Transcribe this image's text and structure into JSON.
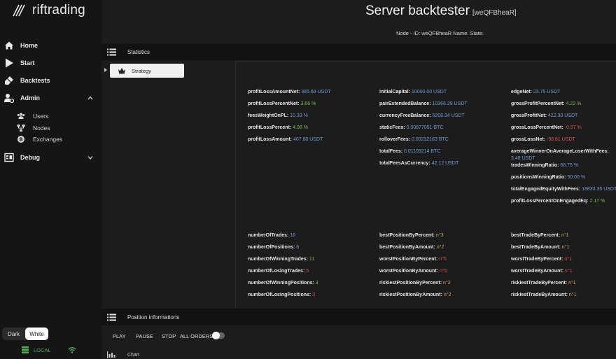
{
  "sidebar": {
    "brand": "riftrading",
    "nav": {
      "home": "Home",
      "start": "Start",
      "backtests": "Backtests",
      "admin": "Admin",
      "users": "Users",
      "nodes": "Nodes",
      "exchanges": "Exchanges",
      "debug": "Debug"
    },
    "theme": {
      "dark": "Dark",
      "white": "White",
      "selected": "White"
    },
    "status": {
      "local": "LOCAL",
      "color": "#4caf50"
    }
  },
  "header": {
    "title": "Server backtester",
    "node_id": "[weQFBheaR]",
    "node_info": "Node - ID: weQFBheaR Name: State:"
  },
  "statistics": {
    "bar_title": "Statistics",
    "tree_item": "Strategy",
    "col1_top": [
      {
        "key": "profitLossAmountNet:",
        "value": "365.69 USDT",
        "color": "blue"
      },
      {
        "key": "profitLossPercentNet:",
        "value": "3.66 %",
        "color": "green"
      },
      {
        "key": "feesWeightOnPL:",
        "value": "10.33 %",
        "color": "blue"
      },
      {
        "key": "profitLossPercent:",
        "value": "4.08 %",
        "color": "green"
      },
      {
        "key": "profitLossAmount:",
        "value": "407.80 USDT",
        "color": "blue"
      }
    ],
    "col2_top": [
      {
        "key": "initialCapital:",
        "value": "10000.00 USDT",
        "color": "blue"
      },
      {
        "key": "pairExtendedBalance:",
        "value": "10366.28 USDT",
        "color": "blue"
      },
      {
        "key": "currencyFreeBalance:",
        "value": "6208.34 USDT",
        "color": "blue"
      },
      {
        "key": "staticFees:",
        "value": "0.00877051 BTC",
        "color": "blue"
      },
      {
        "key": "rolloverFees:",
        "value": "0.00232163 BTC",
        "color": "blue"
      },
      {
        "key": "totalFees:",
        "value": "0.01109214 BTC",
        "color": "blue"
      },
      {
        "key": "totalFeesAsCurrency:",
        "value": "42.12 USDT",
        "color": "blue"
      }
    ],
    "col3_top": [
      {
        "key": "edgeNet:",
        "value": "23.75 USDT",
        "color": "blue"
      },
      {
        "key": "grossProfitPercentNet:",
        "value": "4.22 %",
        "color": "green"
      },
      {
        "key": "grossProfitNet:",
        "value": "422.30 USDT",
        "color": "blue"
      },
      {
        "key": "grossLossPercentNet:",
        "value": "-0.57 %",
        "color": "red"
      },
      {
        "key": "grossLossNet:",
        "value": "-56.61 USDT",
        "color": "red"
      },
      {
        "key": "averageWinnerOnAverageLoserWithFees:",
        "value": "3.48 USDT",
        "color": "blue"
      },
      {
        "key": "tradesWinningRatio:",
        "value": "68.75 %",
        "color": "blue"
      },
      {
        "key": "positionsWinningRatio:",
        "value": "50.00 %",
        "color": "blue"
      },
      {
        "key": "totalEngagedEquityWithFees:",
        "value": "18833.35 USDT",
        "color": "blue"
      },
      {
        "key": "profitLossPercentOnEngagedEq:",
        "value": "2.17 %",
        "color": "green"
      }
    ],
    "col1_bottom": [
      {
        "key": "numberOfTrades:",
        "value": "16",
        "color": "blue"
      },
      {
        "key": "numberOfPositions:",
        "value": "6",
        "color": "blue"
      },
      {
        "key": "numberOfWinningTrades:",
        "value": "11",
        "color": "green"
      },
      {
        "key": "numberOfLosingTrades:",
        "value": "5",
        "color": "red"
      },
      {
        "key": "numberOfWinningPositions:",
        "value": "3",
        "color": "green"
      },
      {
        "key": "numberOfLosingPositions:",
        "value": "3",
        "color": "red"
      }
    ],
    "col2_bottom": [
      {
        "key": "bestPositionByPercent:",
        "value": "n°3",
        "color": "gold"
      },
      {
        "key": "bestPositionByAmount:",
        "value": "n°2",
        "color": "gold"
      },
      {
        "key": "worstPositionByPercent:",
        "value": "n°5",
        "color": "red"
      },
      {
        "key": "worstPositionByAmount:",
        "value": "n°5",
        "color": "red"
      },
      {
        "key": "riskiestPositionByPercent:",
        "value": "n°2",
        "color": "gold"
      },
      {
        "key": "riskiestPositionByAmount:",
        "value": "n°2",
        "color": "gold"
      }
    ],
    "col3_bottom": [
      {
        "key": "bestTradeByPercent:",
        "value": "n°1",
        "color": "gold"
      },
      {
        "key": "bestTradeByAmount:",
        "value": "n°1",
        "color": "gold"
      },
      {
        "key": "worstTradeByPercent:",
        "value": "n°1",
        "color": "red"
      },
      {
        "key": "worstTradeByAmount:",
        "value": "n°1",
        "color": "red"
      },
      {
        "key": "riskiestTradeByPercent:",
        "value": "n°1",
        "color": "gold"
      },
      {
        "key": "riskiestTradeByAmount:",
        "value": "n°1",
        "color": "gold"
      }
    ]
  },
  "positions": {
    "bar_title": "Position informations",
    "play": "PLAY",
    "pause": "PAUSE",
    "stop": "STOP",
    "all_orders": "ALL ORDERS",
    "all_orders_enabled": false,
    "chart_label": "Chart"
  }
}
